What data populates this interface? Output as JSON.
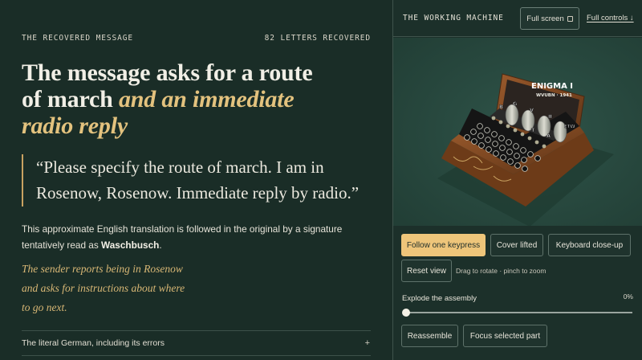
{
  "left": {
    "eyebrow": "THE RECOVERED MESSAGE",
    "count": "82 LETTERS RECOVERED",
    "headline": {
      "line1": "The message asks for a route",
      "line2_plain": "of march ",
      "line2_em": "and an immediate",
      "line3_em": "radio reply"
    },
    "quote": {
      "line1": "“Please specify the route of march. I am in",
      "line2": "Rosenow, Rosenow. Immediate reply by radio.”"
    },
    "body": {
      "line1": "This approximate English translation is followed in the original by a signature",
      "line2_pre": "tentatively read as ",
      "line2_bold": "Waschbusch",
      "line2_post": "."
    },
    "note": {
      "line1": "The sender reports being in Rosenow",
      "line2": "and asks for instructions about where",
      "line3": "to go next."
    },
    "accordion": {
      "label": "The literal German, including its errors",
      "toggle": "+"
    }
  },
  "right": {
    "title": "THE WORKING MACHINE",
    "fullscreen_label": "Full screen",
    "full_controls_label": "Full controls ↓",
    "machine": {
      "name": "ENIGMA I",
      "sub": "WVUBN · 1941",
      "rotor_letters": [
        "B",
        "G",
        "V",
        "T",
        "II",
        "A",
        "ETW"
      ]
    },
    "buttons": {
      "follow": "Follow one keypress",
      "cover": "Cover lifted",
      "keyboard": "Keyboard close-up",
      "reset": "Reset view",
      "reassemble": "Reassemble",
      "focus": "Focus selected part"
    },
    "hint": "Drag to rotate · pinch to zoom",
    "explode": {
      "label": "Explode the assembly",
      "value": "0%",
      "fraction": 0
    }
  }
}
